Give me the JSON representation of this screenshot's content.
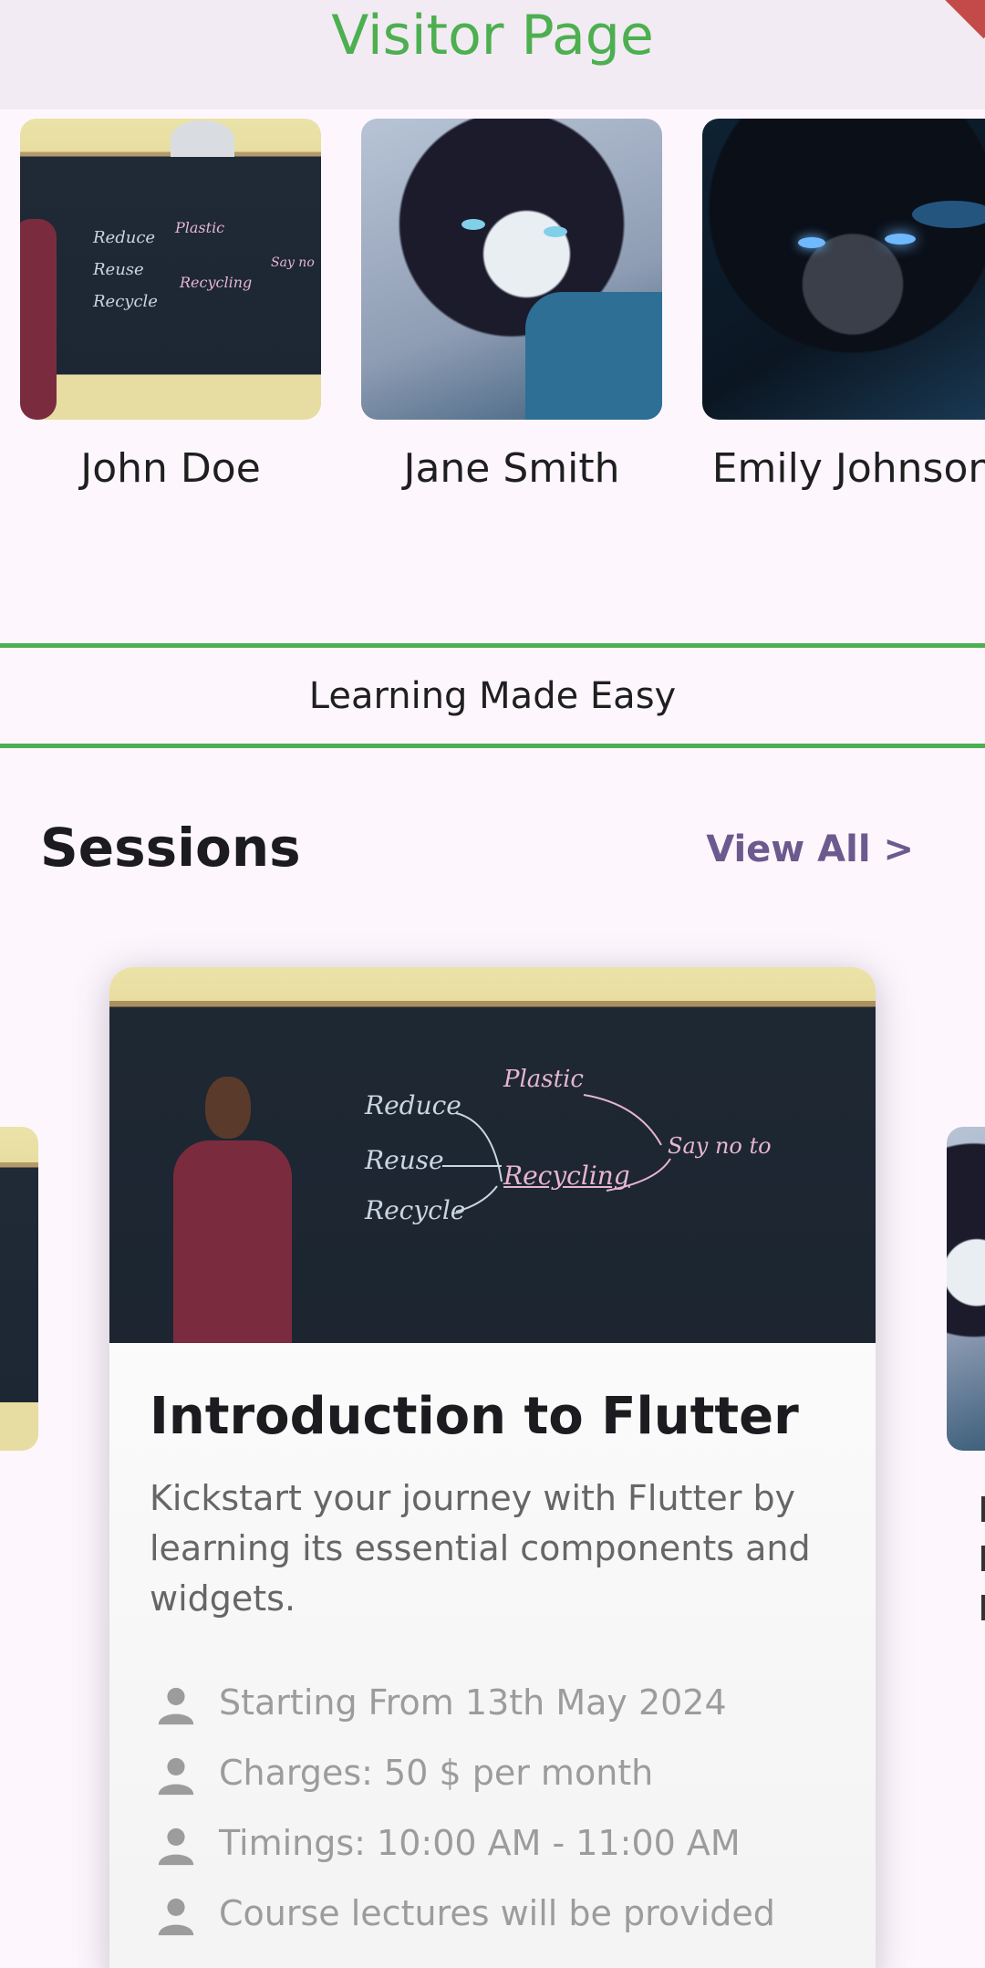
{
  "appbar": {
    "title": "Visitor Page"
  },
  "teachers": [
    {
      "name": "John Doe"
    },
    {
      "name": "Jane Smith"
    },
    {
      "name": "Emily Johnson"
    }
  ],
  "banner": {
    "text": "Learning Made Easy"
  },
  "sessions": {
    "heading": "Sessions",
    "view_all": "View All >",
    "cards": [
      {
        "title": "Introduction to Flutter",
        "description": "Kickstart your journey with Flutter by learning its essential components and widgets.",
        "details": [
          {
            "icon": "person-icon",
            "text": "Starting From 13th May 2024"
          },
          {
            "icon": "person-icon",
            "text": "Charges: 50 $ per month"
          },
          {
            "icon": "person-icon",
            "text": "Timings: 10:00 AM - 11:00 AM"
          },
          {
            "icon": "person-icon",
            "text": "Course lectures will be provided"
          }
        ]
      }
    ]
  },
  "colors": {
    "accent_green": "#4caf50",
    "link_purple": "#6a5a8e",
    "background": "#fdf7fd"
  }
}
